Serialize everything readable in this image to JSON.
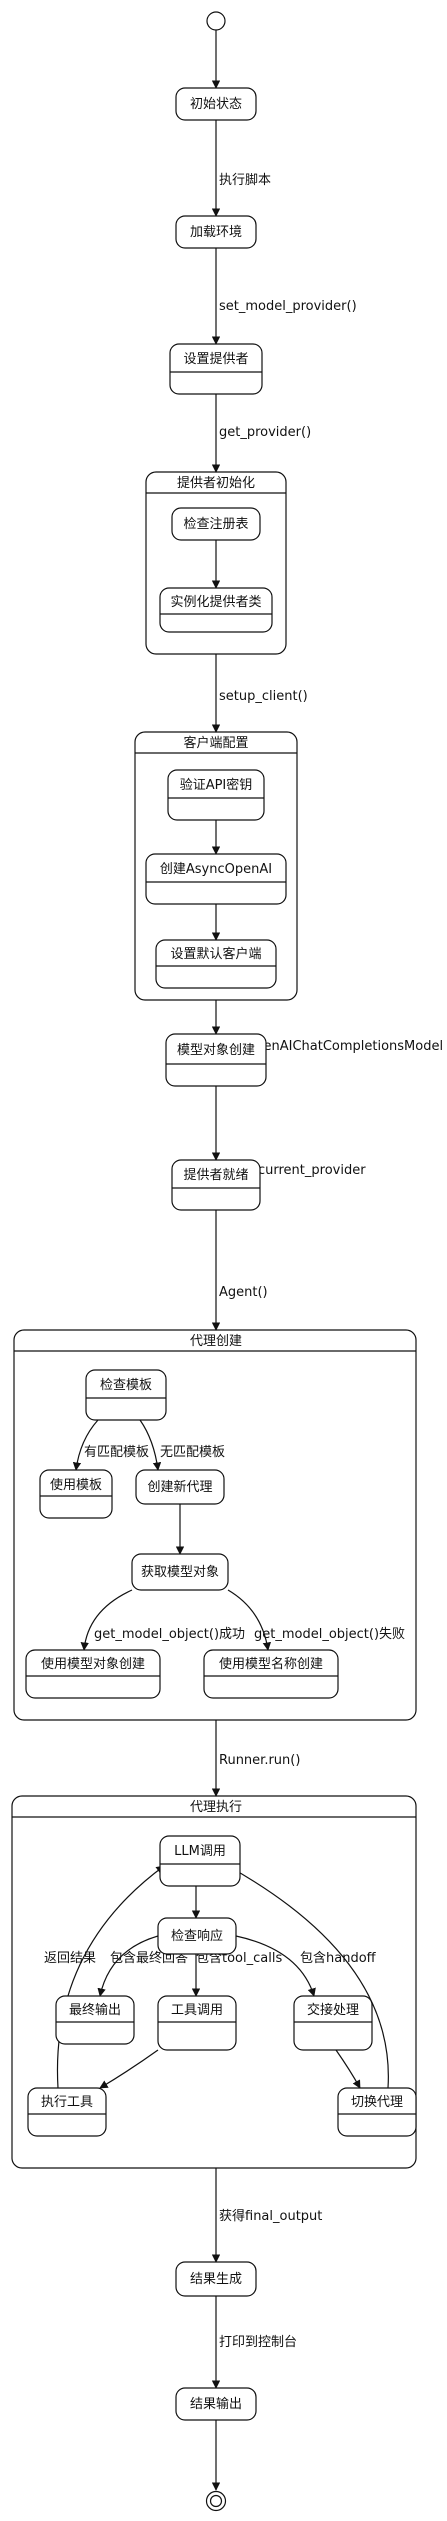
{
  "states": {
    "init": "初始状态",
    "load_env": "加载环境",
    "set_provider": "设置提供者",
    "check_registry": "检查注册表",
    "instantiate_provider": "实例化提供者类",
    "verify_key": "验证API密钥",
    "create_async": "创建AsyncOpenAI",
    "set_default_client": "设置默认客户端",
    "model_create": "模型对象创建",
    "provider_ready": "提供者就绪",
    "check_template": "检查模板",
    "use_template": "使用模板",
    "create_new_agent": "创建新代理",
    "get_model_object": "获取模型对象",
    "create_with_object": "使用模型对象创建",
    "create_with_name": "使用模型名称创建",
    "llm_call": "LLM调用",
    "check_response": "检查响应",
    "final_output": "最终输出",
    "tool_call": "工具调用",
    "handoff": "交接处理",
    "execute_tool": "执行工具",
    "switch_agent": "切换代理",
    "result_gen": "结果生成",
    "result_output": "结果输出"
  },
  "groups": {
    "provider_init": "提供者初始化",
    "client_config": "客户端配置",
    "agent_create": "代理创建",
    "agent_exec": "代理执行"
  },
  "edges": {
    "run_script": "执行脚本",
    "set_model_provider": "set_model_provider()",
    "get_provider": "get_provider()",
    "setup_client": "setup_client()",
    "create_chat_model": "创建OpenAIChatCompletionsModel",
    "save_provider": "保存到current_provider",
    "agent_call": "Agent()",
    "has_template": "有匹配模板",
    "no_template": "无匹配模板",
    "get_model_ok": "get_model_object()成功",
    "get_model_fail": "get_model_object()失败",
    "runner_run": "Runner.run()",
    "return_result": "返回结果",
    "has_final": "包含最终回答",
    "has_tool_calls": "包含tool_calls",
    "has_handoff": "包含handoff",
    "got_final_output": "获得final_output",
    "print_console": "打印到控制台"
  }
}
